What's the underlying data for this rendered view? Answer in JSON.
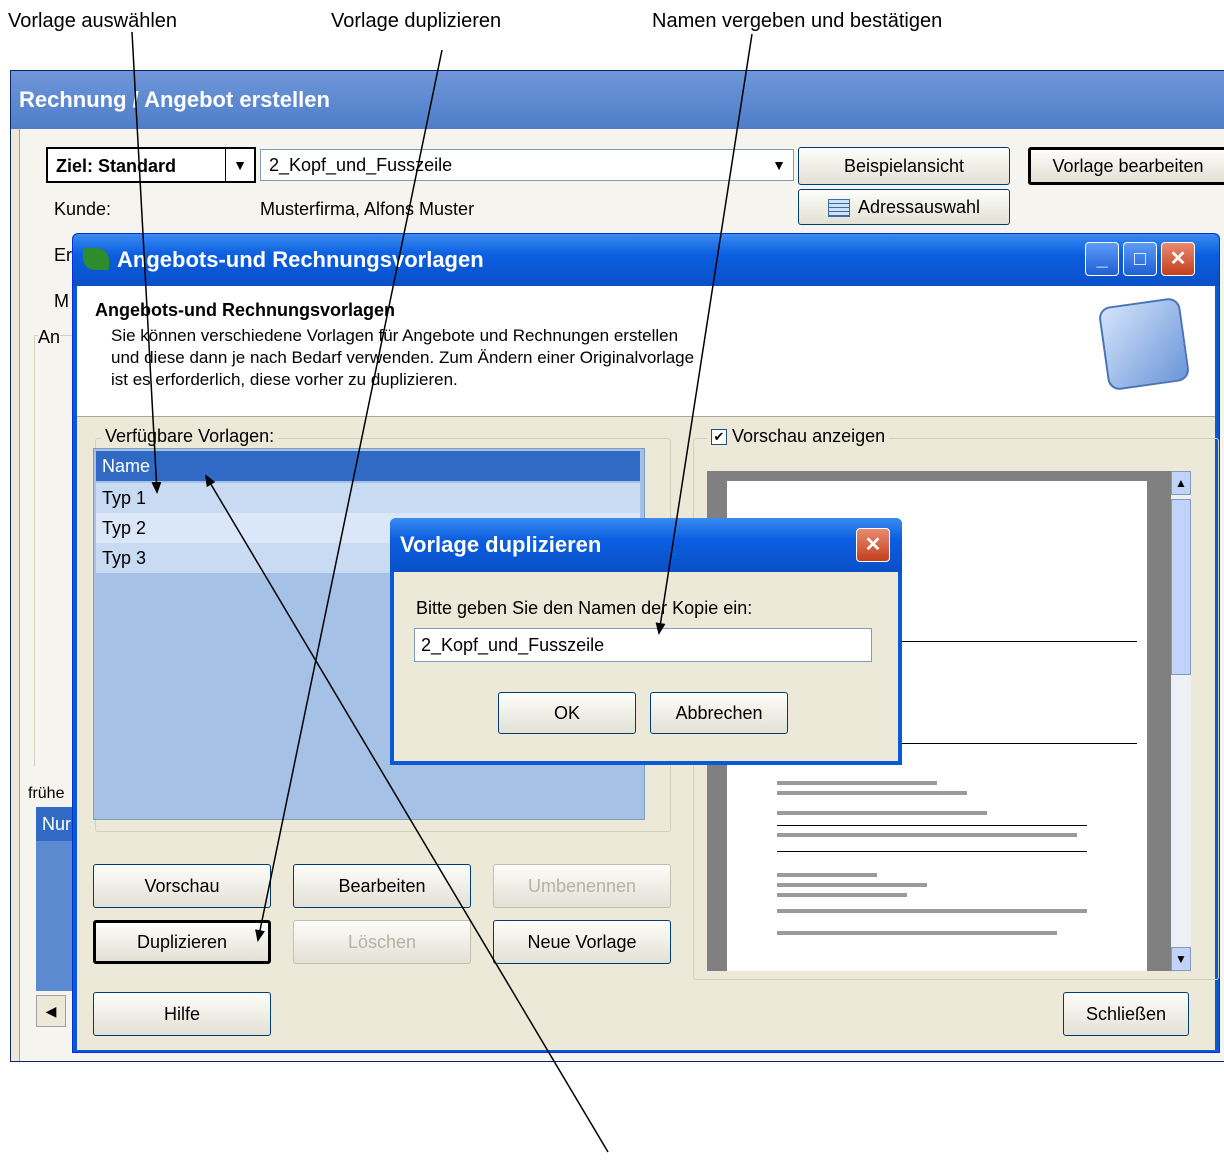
{
  "captions": {
    "select": "Vorlage auswählen",
    "duplicate": "Vorlage duplizieren",
    "name_confirm": "Namen vergeben und bestätigen"
  },
  "back_window": {
    "title": "Rechnung / Angebot erstellen",
    "target_label": "Ziel: Standard",
    "template_combo": "2_Kopf_und_Fusszeile",
    "example_view_button": "Beispielansicht",
    "edit_template_button": "Vorlage bearbeiten",
    "customer_label": "Kunde:",
    "customer_value": "Musterfirma, Alfons Muster",
    "address_select_button": "Adressauswahl",
    "label_e": "Er",
    "label_m": "M",
    "label_an": "An",
    "label_frueher": "frühe",
    "label_nur": "Nur"
  },
  "dialog": {
    "title": "Angebots-und Rechnungsvorlagen",
    "heading": "Angebots-und Rechnungsvorlagen",
    "description_line1": "Sie können verschiedene Vorlagen für Angebote und Rechnungen erstellen",
    "description_line2": "und diese dann je nach Bedarf verwenden. Zum Ändern einer Originalvorlage",
    "description_line3": "ist es erforderlich, diese vorher zu duplizieren.",
    "available_label": "Verfügbare Vorlagen:",
    "templates": [
      "Name",
      "Typ 1",
      "Typ 2",
      "Typ 3"
    ],
    "preview_checkbox_label": "Vorschau anzeigen",
    "buttons": {
      "preview": "Vorschau",
      "edit": "Bearbeiten",
      "rename": "Umbenennen",
      "duplicate": "Duplizieren",
      "delete": "Löschen",
      "new_template": "Neue Vorlage",
      "help": "Hilfe",
      "close": "Schließen"
    }
  },
  "duplicate_dialog": {
    "title": "Vorlage duplizieren",
    "prompt": "Bitte geben Sie den Namen der Kopie ein:",
    "input_value": "2_Kopf_und_Fusszeile",
    "ok": "OK",
    "cancel": "Abbrechen"
  },
  "colors": {
    "title_blue": "#0a5ad6",
    "selection_blue": "#316ac5",
    "list_bg": "#a5c1e6"
  }
}
